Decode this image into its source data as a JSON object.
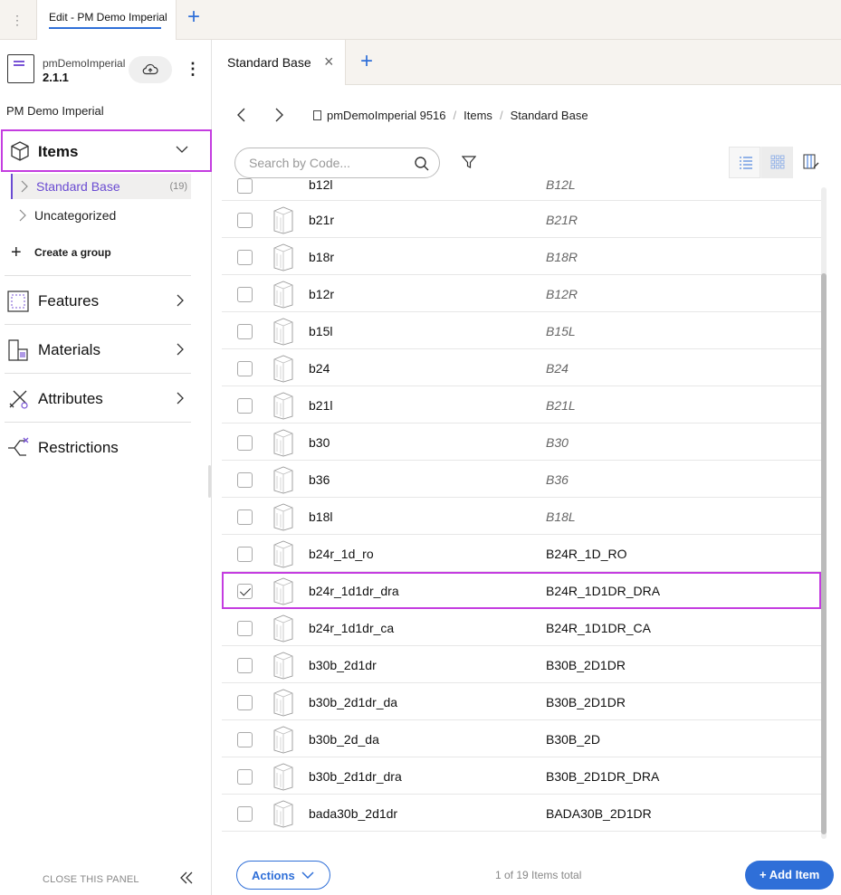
{
  "top_tabs": {
    "active_label": "Edit - PM Demo Imperial"
  },
  "project": {
    "name": "pmDemoImperial",
    "version": "2.1.1",
    "title": "PM Demo Imperial"
  },
  "sidebar": {
    "items_label": "Items",
    "groups": [
      {
        "label": "Standard Base",
        "count": "(19)"
      },
      {
        "label": "Uncategorized"
      }
    ],
    "create_group_label": "Create a group",
    "sections": [
      {
        "label": "Features"
      },
      {
        "label": "Materials"
      },
      {
        "label": "Attributes"
      },
      {
        "label": "Restrictions"
      }
    ],
    "close_panel_label": "CLOSE THIS PANEL"
  },
  "doc_tab": {
    "label": "Standard Base"
  },
  "breadcrumb": {
    "project": "pmDemoImperial 9516",
    "items": "Items",
    "current": "Standard Base"
  },
  "search": {
    "placeholder": "Search by Code..."
  },
  "rows": [
    {
      "code": "b21r",
      "name": "B21R",
      "checked": false
    },
    {
      "code": "b18r",
      "name": "B18R",
      "checked": false
    },
    {
      "code": "b12r",
      "name": "B12R",
      "checked": false
    },
    {
      "code": "b15l",
      "name": "B15L",
      "checked": false
    },
    {
      "code": "b24",
      "name": "B24",
      "checked": false
    },
    {
      "code": "b21l",
      "name": "B21L",
      "checked": false
    },
    {
      "code": "b30",
      "name": "B30",
      "checked": false
    },
    {
      "code": "b36",
      "name": "B36",
      "checked": false
    },
    {
      "code": "b18l",
      "name": "B18L",
      "checked": false
    },
    {
      "code": "b24r_1d_ro",
      "name": "B24R_1D_RO",
      "checked": false
    },
    {
      "code": "b24r_1d1dr_dra",
      "name": "B24R_1D1DR_DRA",
      "checked": true
    },
    {
      "code": "b24r_1d1dr_ca",
      "name": "B24R_1D1DR_CA",
      "checked": false
    },
    {
      "code": "b30b_2d1dr",
      "name": "B30B_2D1DR",
      "checked": false
    },
    {
      "code": "b30b_2d1dr_da",
      "name": "B30B_2D1DR",
      "checked": false
    },
    {
      "code": "b30b_2d_da",
      "name": "B30B_2D",
      "checked": false
    },
    {
      "code": "b30b_2d1dr_dra",
      "name": "B30B_2D1DR_DRA",
      "checked": false
    },
    {
      "code": "bada30b_2d1dr",
      "name": "BADA30B_2D1DR",
      "checked": false
    }
  ],
  "partial_row": {
    "code": "b12l",
    "name": "B12L"
  },
  "footer": {
    "actions_label": "Actions",
    "count_text": "1 of 19 Items total",
    "add_label": "+ Add Item"
  },
  "colors": {
    "accent": "#2f6fd8",
    "highlight": "#c43de0",
    "selected": "#6a4bd2"
  }
}
